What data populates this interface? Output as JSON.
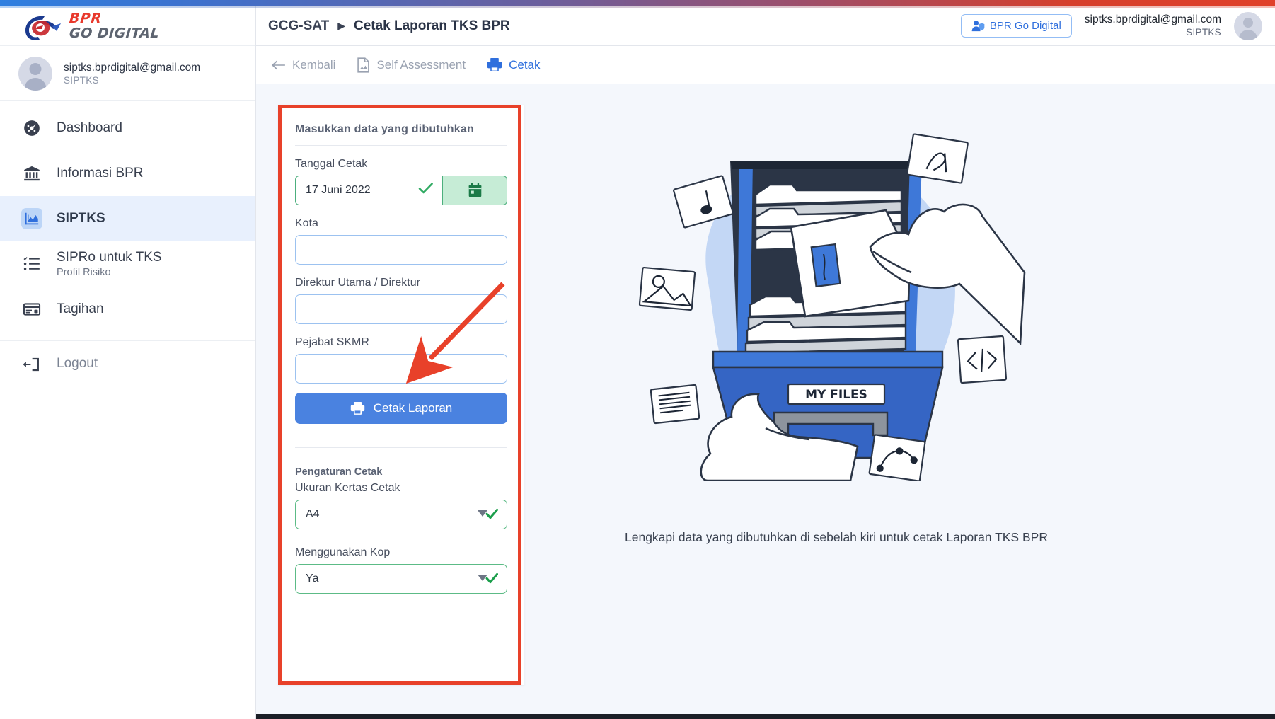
{
  "brand": {
    "line1": "BPR",
    "line2": "GO DIGITAL"
  },
  "sidebar": {
    "user": {
      "email": "siptks.bprdigital@gmail.com",
      "role": "SIPTKS"
    },
    "items": [
      {
        "label": "Dashboard",
        "icon": "dashboard-gauge-icon",
        "sub": ""
      },
      {
        "label": "Informasi BPR",
        "icon": "bank-icon",
        "sub": ""
      },
      {
        "label": "SIPTKS",
        "icon": "chart-area-icon",
        "sub": ""
      },
      {
        "label": "SIPRo untuk TKS",
        "icon": "checklist-icon",
        "sub": "Profil Risiko"
      },
      {
        "label": "Tagihan",
        "icon": "card-icon",
        "sub": ""
      }
    ],
    "logout": {
      "label": "Logout",
      "icon": "logout-icon"
    }
  },
  "header": {
    "breadcrumb_root": "GCG-SAT",
    "breadcrumb_sep": "▶",
    "breadcrumb_leaf": "Cetak Laporan TKS BPR",
    "badge_label": "BPR Go Digital",
    "badge_icon": "user-shield-icon",
    "user_email": "siptks.bprdigital@gmail.com",
    "user_role": "SIPTKS"
  },
  "toolbar": {
    "back_label": "Kembali",
    "back_icon": "arrow-left-icon",
    "self_assessment_label": "Self Assessment",
    "self_assessment_icon": "document-icon",
    "print_label": "Cetak",
    "print_icon": "printer-icon"
  },
  "form": {
    "title": "Masukkan data yang dibutuhkan",
    "tanggal_label": "Tanggal Cetak",
    "tanggal_value": "17 Juni 2022",
    "tanggal_valid_icon": "check-icon",
    "calendar_icon": "calendar-icon",
    "kota_label": "Kota",
    "kota_value": "",
    "kota_placeholder": "",
    "direktur_label": "Direktur Utama / Direktur",
    "direktur_value": "",
    "direktur_placeholder": "",
    "skmr_label": "Pejabat SKMR",
    "skmr_value": "",
    "skmr_placeholder": "",
    "print_button_label": "Cetak Laporan",
    "print_button_icon": "printer-icon",
    "settings_title": "Pengaturan Cetak",
    "paper_label": "Ukuran Kertas Cetak",
    "paper_value": "A4",
    "kop_label": "Menggunakan Kop",
    "kop_value": "Ya",
    "select_caret_icon": "chevron-down-icon",
    "select_check_icon": "check-icon"
  },
  "illustration": {
    "drawer_label": "MY FILES",
    "float_icons": [
      "music-note-icon",
      "photo-icon",
      "text-aa-icon",
      "code-icon",
      "lines-doc-icon",
      "vector-node-icon"
    ]
  },
  "main": {
    "caption": "Lengkapi data yang dibutuhkan di sebelah kiri untuk cetak Laporan TKS BPR"
  },
  "annotations": {
    "box_color": "#e8412a",
    "arrow_color": "#e8412a"
  },
  "colors": {
    "accent_blue": "#2f6fdd",
    "button_blue": "#4a82e0",
    "valid_green": "#2faa62",
    "brand_red": "#e8392c",
    "content_bg": "#f4f7fc"
  }
}
